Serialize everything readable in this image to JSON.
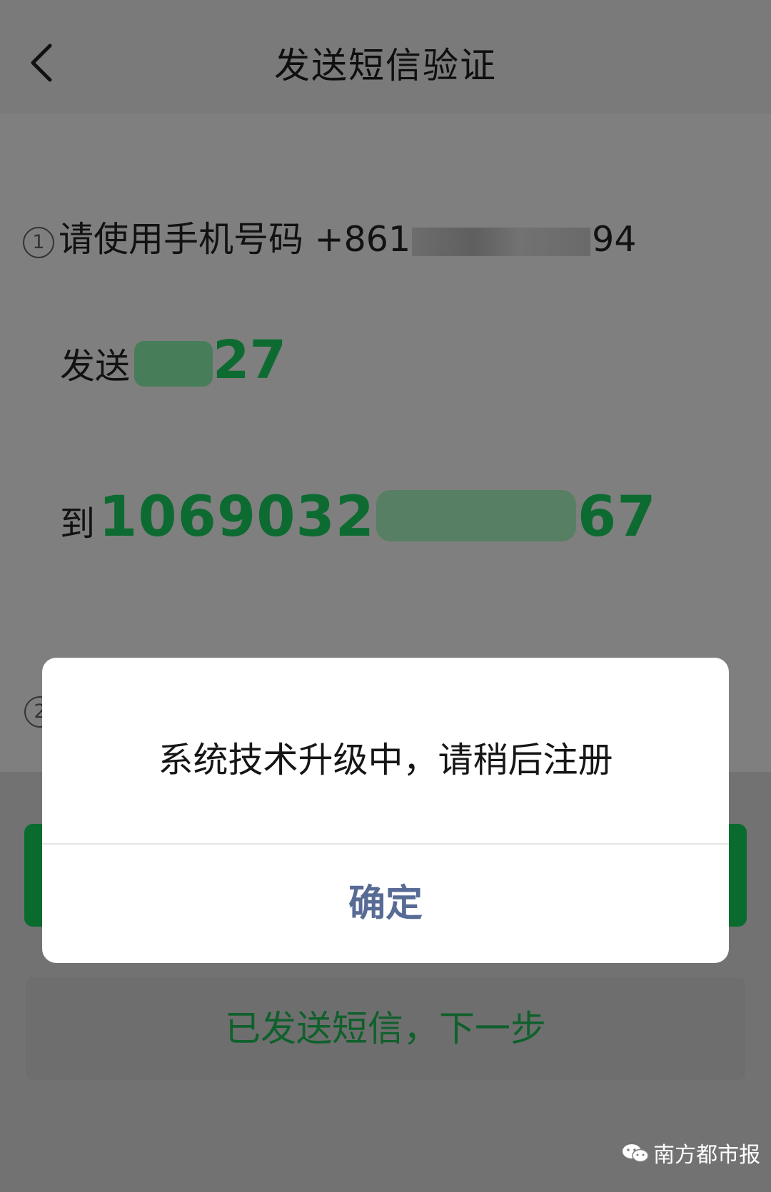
{
  "header": {
    "title": "发送短信验证",
    "back_icon": "chevron-left-icon"
  },
  "step1": {
    "marker": "1",
    "instruction": "请使用手机号码 +86",
    "phone_prefix_partial": "1",
    "phone_suffix": "94"
  },
  "send": {
    "label": "发送",
    "code_suffix": "27"
  },
  "to": {
    "label": "到",
    "number_prefix": "1069032",
    "number_suffix": "67"
  },
  "step2": {
    "marker": "2"
  },
  "next_button": {
    "label": "已发送短信，下一步"
  },
  "dialog": {
    "message": "系统技术升级中，请稍后注册",
    "confirm_label": "确定"
  },
  "watermark": {
    "text": "南方都市报",
    "icon": "wechat-icon"
  },
  "colors": {
    "accent_green": "#0d6b31",
    "dialog_button": "#576b95"
  }
}
